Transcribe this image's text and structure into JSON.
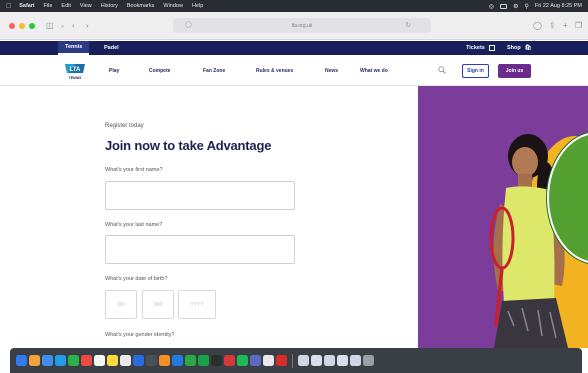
{
  "menubar": {
    "app": "Safari",
    "items": [
      "File",
      "Edit",
      "View",
      "History",
      "Bookmarks",
      "Window",
      "Help"
    ],
    "datetime": "Fri 22 Aug 8:25 PM"
  },
  "browser": {
    "url": "lta.org.uk"
  },
  "topnav": {
    "tabs": [
      "Tennis",
      "Padel"
    ],
    "tickets": "Tickets",
    "shop": "Shop"
  },
  "mainnav": {
    "logo_text": "LTA",
    "logo_sub": "TENNIS",
    "items": [
      "Play",
      "Compete",
      "Fan Zone",
      "Rules & venues",
      "News",
      "What we do"
    ],
    "signin": "Sign in",
    "joinus": "Join us"
  },
  "form": {
    "kicker": "Register today",
    "title": "Join now to take Advantage",
    "first_name_label": "What's your first name?",
    "last_name_label": "What's your last name?",
    "dob_label": "What's your date of birth?",
    "dob_dd": "DD",
    "dob_mm": "MM",
    "dob_yyyy": "YYYY",
    "gender_label": "What's your gender identity?"
  },
  "colors": {
    "navy": "#17205a",
    "purple": "#7c3c9a",
    "yellow": "#f3b320",
    "green": "#54a132",
    "join_purple": "#6a2b8c"
  }
}
